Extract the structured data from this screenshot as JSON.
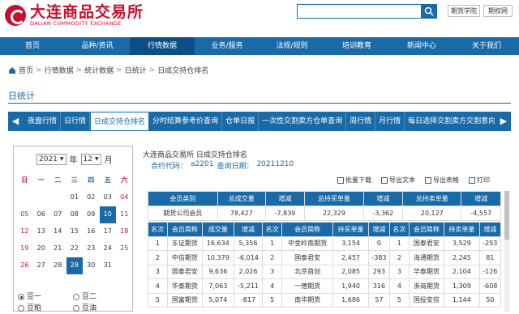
{
  "header": {
    "logo_cn": "大连商品交易所",
    "logo_en": "DALIAN COMMODITY EXCHANGE",
    "links": [
      "期货学院",
      "期权网"
    ]
  },
  "nav": [
    "首页",
    "品种/资讯",
    "行情数据",
    "业务/服务",
    "法规/规则",
    "培训教育",
    "新闻中心",
    "关于我们"
  ],
  "nav_active": 2,
  "breadcrumb": [
    "首页",
    "行情数据",
    "统计数据",
    "日统计",
    "日成交持仓排名"
  ],
  "page_title": "日统计",
  "subtabs": [
    "夜盘行情",
    "日行情",
    "日成交持仓排名",
    "分时结算参考价查询",
    "仓单日报",
    "一次性交割卖方仓单查询",
    "周行情",
    "月行情",
    "每日选择交割卖方交割意向表"
  ],
  "subtab_active": 2,
  "calendar": {
    "year": "2021",
    "year_label": "年",
    "month": "12",
    "month_label": "月",
    "weekdays": [
      "日",
      "一",
      "二",
      "三",
      "四",
      "五",
      "六"
    ],
    "weeks": [
      [
        "",
        "",
        "",
        "01",
        "02",
        "03",
        "04"
      ],
      [
        "05",
        "06",
        "07",
        "08",
        "09",
        "10",
        "11"
      ],
      [
        "12",
        "13",
        "14",
        "15",
        "16",
        "17",
        "18"
      ],
      [
        "19",
        "20",
        "21",
        "22",
        "23",
        "24",
        "25"
      ],
      [
        "26",
        "27",
        "28",
        "29",
        "30",
        "31",
        ""
      ]
    ],
    "highlighted": [
      "10",
      "29"
    ]
  },
  "radios": [
    {
      "label": "豆一",
      "checked": true
    },
    {
      "label": "豆二",
      "checked": false
    },
    {
      "label": "豆粕",
      "checked": false
    },
    {
      "label": "豆油",
      "checked": false
    }
  ],
  "report": {
    "title": "大连商品交易所 日成交持仓排名",
    "contract_label": "合约代码：",
    "contract": "a2201",
    "date_label": "查询日期：",
    "date": "20211210"
  },
  "tools": [
    "批量下载",
    "导出文本",
    "导出表格",
    "打印"
  ],
  "summary_table": {
    "headers": [
      "会员类别",
      "总成交量",
      "增减",
      "总持买单量",
      "增减",
      "总持卖单量",
      "增减"
    ],
    "row": [
      "期货公司会员",
      "78,427",
      "-7,839",
      "22,329",
      "-3,362",
      "20,127",
      "-4,557"
    ]
  },
  "rank_table": {
    "headers": [
      "名次",
      "会员简称",
      "成交量",
      "增减",
      "名次",
      "会员简称",
      "持买单量",
      "增减",
      "名次",
      "会员简称",
      "持卖单量",
      "增减"
    ],
    "rows": [
      [
        "1",
        "东证期货",
        "16,634",
        "5,356",
        "1",
        "中金岭南期货",
        "3,154",
        "0",
        "1",
        "国泰君安",
        "3,529",
        "-253"
      ],
      [
        "2",
        "中信期货",
        "10,379",
        "-6,014",
        "2",
        "国泰君安",
        "2,457",
        "-383",
        "2",
        "海通期货",
        "2,245",
        "81"
      ],
      [
        "3",
        "国泰君安",
        "9,636",
        "2,026",
        "3",
        "北京首创",
        "2,085",
        "293",
        "3",
        "华泰期货",
        "2,104",
        "-126"
      ],
      [
        "4",
        "华泰期货",
        "7,063",
        "-5,211",
        "4",
        "一德期货",
        "1,940",
        "316",
        "4",
        "浙商期货",
        "1,309",
        "-608"
      ],
      [
        "5",
        "国富期货",
        "5,074",
        "-817",
        "5",
        "南华期货",
        "1,686",
        "57",
        "5",
        "国投安信",
        "1,144",
        "50"
      ]
    ]
  },
  "colors": {
    "brand": "#1a6aa8",
    "nav_active": "#0b4f86",
    "logo": "#c8102e"
  }
}
